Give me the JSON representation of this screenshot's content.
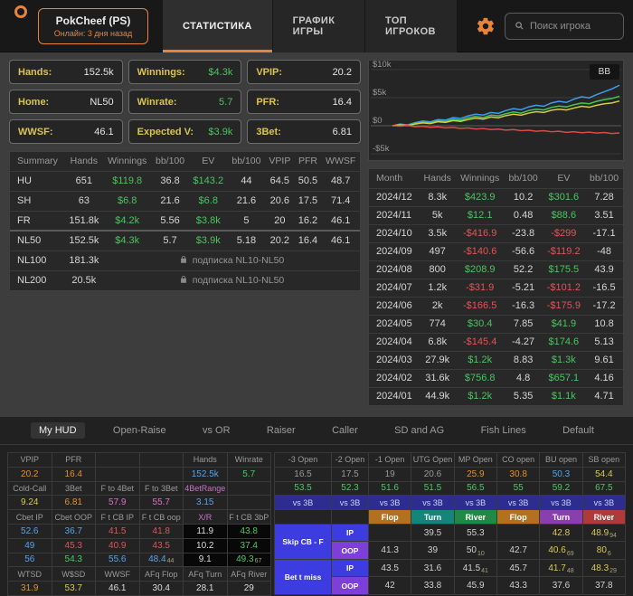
{
  "header": {
    "player": {
      "name": "PokCheef (PS)",
      "status": "Онлайн: 3 дня назад"
    },
    "tabs": [
      {
        "label": "СТАТИСТИКА",
        "active": true
      },
      {
        "label": "ГРАФИК ИГРЫ",
        "active": false
      },
      {
        "label": "ТОП ИГРОКОВ",
        "active": false
      }
    ],
    "search_placeholder": "Поиск игрока"
  },
  "stat_boxes": [
    {
      "label": "Hands:",
      "value": "152.5k",
      "color": "white"
    },
    {
      "label": "Winnings:",
      "value": "$4.3k",
      "color": "green"
    },
    {
      "label": "VPIP:",
      "value": "20.2",
      "color": "white"
    },
    {
      "label": "Home:",
      "value": "NL50",
      "color": "white"
    },
    {
      "label": "Winrate:",
      "value": "5.7",
      "color": "green"
    },
    {
      "label": "PFR:",
      "value": "16.4",
      "color": "white"
    },
    {
      "label": "WWSF:",
      "value": "46.1",
      "color": "white"
    },
    {
      "label": "Expected V:",
      "value": "$3.9k",
      "color": "green"
    },
    {
      "label": "3Bet:",
      "value": "6.81",
      "color": "white"
    }
  ],
  "summary_table": {
    "headers": [
      "Summary",
      "Hands",
      "Winnings",
      "bb/100",
      "EV",
      "bb/100",
      "VPIP",
      "PFR",
      "WWSF"
    ],
    "rows": [
      [
        "HU",
        "651",
        "$119.8",
        "36.8",
        "$143.2",
        "44",
        "64.5",
        "50.5",
        "48.7"
      ],
      [
        "SH",
        "63",
        "$6.8",
        "21.6",
        "$6.8",
        "21.6",
        "20.6",
        "17.5",
        "71.4"
      ],
      [
        "FR",
        "151.8k",
        "$4.2k",
        "5.56",
        "$3.8k",
        "5",
        "20",
        "16.2",
        "46.1"
      ],
      [
        "NL50",
        "152.5k",
        "$4.3k",
        "5.7",
        "$3.9k",
        "5.18",
        "20.2",
        "16.4",
        "46.1"
      ]
    ],
    "locked_rows": [
      {
        "label": "NL100",
        "hands": "181.3k",
        "note": "подписка NL10-NL50"
      },
      {
        "label": "NL200",
        "hands": "20.5k",
        "note": "подписка NL10-NL50"
      }
    ]
  },
  "chart": {
    "legend_label": "BB",
    "y_ticks": [
      {
        "label": "$10k",
        "v": 10
      },
      {
        "label": "$5k",
        "v": 5
      },
      {
        "label": "$0",
        "v": 0
      },
      {
        "label": "-$5k",
        "v": -5
      }
    ],
    "series": [
      {
        "name": "blue-line",
        "color": "#3d9df0",
        "values": [
          0,
          0.3,
          0.15,
          0.55,
          0.85,
          0.7,
          1.1,
          1.0,
          1.45,
          1.3,
          1.75,
          2.05,
          1.9,
          2.35,
          2.2,
          2.7,
          3.05,
          2.85,
          3.35,
          3.65,
          3.45,
          4.05,
          4.35,
          4.15,
          4.75,
          5.15,
          4.95,
          5.55,
          6.05,
          6.55,
          7.2
        ]
      },
      {
        "name": "green-line",
        "color": "#46c74f",
        "values": [
          0,
          0.2,
          0.05,
          0.4,
          0.65,
          0.5,
          0.9,
          0.75,
          1.15,
          1.0,
          1.4,
          1.65,
          1.45,
          1.9,
          1.75,
          2.15,
          2.45,
          2.25,
          2.7,
          2.95,
          2.8,
          3.25,
          3.5,
          3.35,
          3.75,
          4.05,
          3.9,
          4.35,
          4.65,
          4.85,
          5.25
        ]
      },
      {
        "name": "yellow-line",
        "color": "#d6cd3e",
        "values": [
          0,
          0.12,
          0,
          0.3,
          0.5,
          0.38,
          0.7,
          0.58,
          0.9,
          0.78,
          1.1,
          1.35,
          1.18,
          1.55,
          1.42,
          1.8,
          2.05,
          1.88,
          2.25,
          2.5,
          2.35,
          2.75,
          2.95,
          2.8,
          3.15,
          3.45,
          3.3,
          3.65,
          3.9,
          4.05,
          4.4
        ]
      },
      {
        "name": "red-line",
        "color": "#e04848",
        "values": [
          0,
          -0.08,
          0.05,
          -0.18,
          -0.1,
          -0.28,
          -0.2,
          -0.38,
          -0.3,
          -0.48,
          -0.4,
          -0.58,
          -0.5,
          -0.68,
          -0.6,
          -0.78,
          -0.68,
          -0.88,
          -0.8,
          -0.98,
          -0.88,
          -1.08,
          -0.98,
          -1.18,
          -1.08,
          -1.25,
          -1.15,
          -1.32,
          -1.2,
          -1.38,
          -1.28
        ]
      }
    ]
  },
  "monthly_table": {
    "headers": [
      "Month",
      "Hands",
      "Winnings",
      "bb/100",
      "EV",
      "bb/100"
    ],
    "rows": [
      [
        "2024/12",
        "8.3k",
        "$423.9",
        "10.2",
        "$301.6",
        "7.28"
      ],
      [
        "2024/11",
        "5k",
        "$12.1",
        "0.48",
        "$88.6",
        "3.51"
      ],
      [
        "2024/10",
        "3.5k",
        "-$416.9",
        "-23.8",
        "-$299",
        "-17.1"
      ],
      [
        "2024/09",
        "497",
        "-$140.6",
        "-56.6",
        "-$119.2",
        "-48"
      ],
      [
        "2024/08",
        "800",
        "$208.9",
        "52.2",
        "$175.5",
        "43.9"
      ],
      [
        "2024/07",
        "1.2k",
        "-$31.9",
        "-5.21",
        "-$101.2",
        "-16.5"
      ],
      [
        "2024/06",
        "2k",
        "-$166.5",
        "-16.3",
        "-$175.9",
        "-17.2"
      ],
      [
        "2024/05",
        "774",
        "$30.4",
        "7.85",
        "$41.9",
        "10.8"
      ],
      [
        "2024/04",
        "6.8k",
        "-$145.4",
        "-4.27",
        "$174.6",
        "5.13"
      ],
      [
        "2024/03",
        "27.9k",
        "$1.2k",
        "8.83",
        "$1.3k",
        "9.61"
      ],
      [
        "2024/02",
        "31.6k",
        "$756.8",
        "4.8",
        "$657.1",
        "4.16"
      ],
      [
        "2024/01",
        "44.9k",
        "$1.2k",
        "5.35",
        "$1.1k",
        "4.71"
      ]
    ]
  },
  "hud": {
    "tabs": [
      {
        "label": "My HUD",
        "active": true
      },
      {
        "label": "Open-Raise",
        "active": false
      },
      {
        "label": "vs OR",
        "active": false
      },
      {
        "label": "Raiser",
        "active": false
      },
      {
        "label": "Caller",
        "active": false
      },
      {
        "label": "SD and AG",
        "active": false
      },
      {
        "label": "Fish Lines",
        "active": false
      },
      {
        "label": "Default",
        "active": false
      }
    ],
    "left": {
      "rows": [
        [
          {
            "t": "VPIP",
            "k": "hdr"
          },
          {
            "t": "PFR",
            "k": "hdr"
          },
          {
            "t": ""
          },
          {
            "t": ""
          },
          {
            "t": "Hands",
            "k": "hdr"
          },
          {
            "t": "Winrate",
            "k": "hdr"
          }
        ],
        [
          {
            "t": "20.2",
            "k": "orange"
          },
          {
            "t": "16.4",
            "k": "orange"
          },
          {
            "t": ""
          },
          {
            "t": ""
          },
          {
            "t": "152.5k",
            "k": "blue"
          },
          {
            "t": "5.7",
            "k": "green"
          }
        ],
        [
          {
            "t": "Cold-Call",
            "k": "hdr"
          },
          {
            "t": "3Bet",
            "k": "hdr"
          },
          {
            "t": "F to 4Bet",
            "k": "hdr"
          },
          {
            "t": "F to 3Bet",
            "k": "hdr"
          },
          {
            "t": "4BetRange",
            "k": "hdr-pink"
          },
          {
            "t": ""
          }
        ],
        [
          {
            "t": "9.24",
            "k": "yellow"
          },
          {
            "t": "6.81",
            "k": "orange"
          },
          {
            "t": "57.9",
            "k": "pink"
          },
          {
            "t": "55.7",
            "k": "pink"
          },
          {
            "t": "3.15",
            "k": "blue"
          },
          {
            "t": ""
          }
        ],
        [
          {
            "t": "Cbet IP",
            "k": "hdr"
          },
          {
            "t": "Cbet OOP",
            "k": "hdr"
          },
          {
            "t": "F t CB IP",
            "k": "hdr"
          },
          {
            "t": "F t CB oop",
            "k": "hdr"
          },
          {
            "t": "X/R",
            "k": "hdr-pink"
          },
          {
            "t": "F t CB 3bP",
            "k": "hdr"
          }
        ],
        [
          {
            "t": "52.6",
            "k": "blue"
          },
          {
            "t": "36.7",
            "k": "blue"
          },
          {
            "t": "41.5",
            "k": "red"
          },
          {
            "t": "41.8",
            "k": "red"
          },
          {
            "t": "11.9",
            "k": "white",
            "bg": "black"
          },
          {
            "t": "43.8",
            "k": "green",
            "bg": "black"
          }
        ],
        [
          {
            "t": "49",
            "k": "blue"
          },
          {
            "t": "45.3",
            "k": "red"
          },
          {
            "t": "40.9",
            "k": "red"
          },
          {
            "t": "43.5",
            "k": "red"
          },
          {
            "t": "10.2",
            "k": "white",
            "bg": "black"
          },
          {
            "t": "37.4",
            "k": "green",
            "bg": "black"
          }
        ],
        [
          {
            "t": "56",
            "k": "blue"
          },
          {
            "t": "54.3",
            "k": "green"
          },
          {
            "t": "55.6",
            "k": "blue"
          },
          {
            "t": "48.4",
            "k": "blue",
            "sub": "44"
          },
          {
            "t": "9.1",
            "k": "white",
            "bg": "black"
          },
          {
            "t": "49.3",
            "k": "green",
            "bg": "black",
            "sub": "67"
          }
        ],
        [
          {
            "t": "WTSD",
            "k": "hdr"
          },
          {
            "t": "W$SD",
            "k": "hdr"
          },
          {
            "t": "WWSF",
            "k": "hdr"
          },
          {
            "t": "AFq Flop",
            "k": "hdr"
          },
          {
            "t": "AFq Turn",
            "k": "hdr"
          },
          {
            "t": "AFq River",
            "k": "hdr"
          }
        ],
        [
          {
            "t": "31.9",
            "k": "orange"
          },
          {
            "t": "53.7",
            "k": "yellow"
          },
          {
            "t": "46.1",
            "k": "white"
          },
          {
            "t": "30.4",
            "k": "white"
          },
          {
            "t": "28.1",
            "k": "white"
          },
          {
            "t": "29",
            "k": "white"
          }
        ]
      ]
    },
    "right": {
      "rows": [
        [
          {
            "t": "-3 Open",
            "k": "hdr"
          },
          {
            "t": "-2 Open",
            "k": "hdr"
          },
          {
            "t": "-1 Open",
            "k": "hdr"
          },
          {
            "t": "UTG Open",
            "k": "hdr"
          },
          {
            "t": "MP Open",
            "k": "hdr"
          },
          {
            "t": "CO open",
            "k": "hdr"
          },
          {
            "t": "BU open",
            "k": "hdr"
          },
          {
            "t": "SB open",
            "k": "hdr"
          }
        ],
        [
          {
            "t": "16.5",
            "k": "gray"
          },
          {
            "t": "17.5",
            "k": "gray"
          },
          {
            "t": "19",
            "k": "gray"
          },
          {
            "t": "20.6",
            "k": "gray"
          },
          {
            "t": "25.9",
            "k": "orange"
          },
          {
            "t": "30.8",
            "k": "orange"
          },
          {
            "t": "50.3",
            "k": "blue"
          },
          {
            "t": "54.4",
            "k": "yellow"
          }
        ],
        [
          {
            "t": "53.5",
            "k": "green"
          },
          {
            "t": "52.3",
            "k": "green"
          },
          {
            "t": "51.6",
            "k": "green"
          },
          {
            "t": "51.5",
            "k": "green"
          },
          {
            "t": "56.5",
            "k": "green"
          },
          {
            "t": "55",
            "k": "green"
          },
          {
            "t": "59.2",
            "k": "green"
          },
          {
            "t": "67.5",
            "k": "green"
          }
        ],
        [
          {
            "t": "vs 3B",
            "k": "lav",
            "bg": "navy"
          },
          {
            "t": "vs 3B",
            "k": "lav",
            "bg": "navy"
          },
          {
            "t": "vs 3B",
            "k": "lav",
            "bg": "navy"
          },
          {
            "t": "vs 3B",
            "k": "lav",
            "bg": "navy"
          },
          {
            "t": "vs 3B",
            "k": "lav",
            "bg": "navy"
          },
          {
            "t": "vs 3B",
            "k": "lav",
            "bg": "navy"
          },
          {
            "t": "vs 3B",
            "k": "lav",
            "bg": "navy"
          },
          {
            "t": "vs 3B",
            "k": "lav",
            "bg": "navy"
          }
        ],
        [
          {
            "t": ""
          },
          {
            "t": ""
          },
          {
            "t": "Flop",
            "bg": "flop"
          },
          {
            "t": "Turn",
            "bg": "turn"
          },
          {
            "t": "River",
            "bg": "river"
          },
          {
            "t": "Flop",
            "bg": "flop"
          },
          {
            "t": "Turn",
            "bg": "turn2"
          },
          {
            "t": "River",
            "bg": "river2"
          }
        ],
        [
          {
            "t": "Skip CB - F",
            "bg": "ip",
            "rowspan": 2
          },
          {
            "t": "IP",
            "bg": "ip"
          },
          {
            "t": ""
          },
          {
            "t": "39.5"
          },
          {
            "t": "55.3"
          },
          {
            "t": ""
          },
          {
            "t": "42.8",
            "k": "yellow"
          },
          {
            "t": "48.9",
            "k": "yellow",
            "sub": "94"
          }
        ],
        [
          {
            "skip": true
          },
          {
            "t": "OOP",
            "bg": "oop"
          },
          {
            "t": "41.3"
          },
          {
            "t": "39"
          },
          {
            "t": "50",
            "sub": "10"
          },
          {
            "t": "42.7"
          },
          {
            "t": "40.6",
            "k": "yellow",
            "sub": "69"
          },
          {
            "t": "80",
            "k": "yellow",
            "sub": "6"
          }
        ],
        [
          {
            "t": "Bet t miss",
            "bg": "ip",
            "rowspan": 2
          },
          {
            "t": "IP",
            "bg": "ip"
          },
          {
            "t": "43.5"
          },
          {
            "t": "31.6"
          },
          {
            "t": "41.5",
            "sub": "41"
          },
          {
            "t": "45.7"
          },
          {
            "t": "41.7",
            "k": "yellow",
            "sub": "48"
          },
          {
            "t": "48.3",
            "k": "yellow",
            "sub": "29"
          }
        ],
        [
          {
            "skip": true
          },
          {
            "t": "OOP",
            "bg": "oop"
          },
          {
            "t": "42"
          },
          {
            "t": "33.8"
          },
          {
            "t": "45.9"
          },
          {
            "t": "43.3"
          },
          {
            "t": "37.6"
          },
          {
            "t": "37.8"
          }
        ]
      ]
    }
  }
}
